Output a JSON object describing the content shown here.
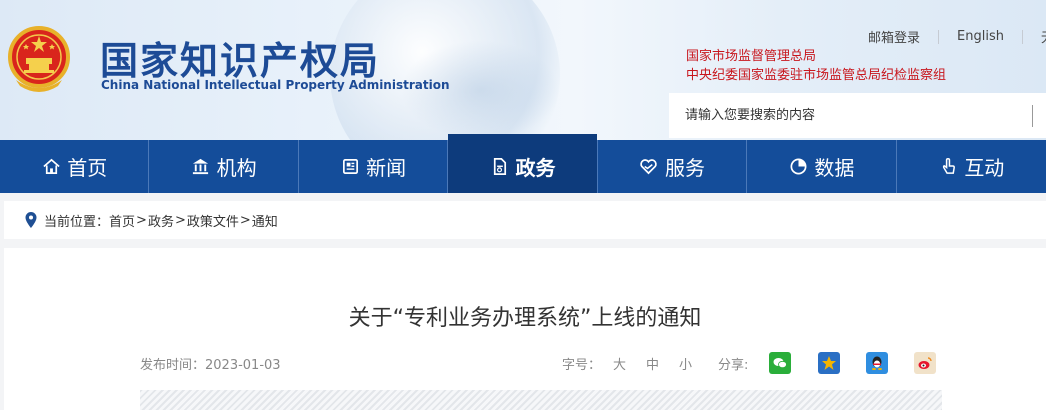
{
  "header": {
    "logo_cn": "国家知识产权局",
    "logo_en": "China National Intellectual Property Administration",
    "top_links": {
      "mail_login": "邮箱登录",
      "english": "English",
      "more": "无"
    },
    "orgs": [
      "国家市场监督管理总局",
      "中央纪委国家监委驻市场监管总局纪检监察组"
    ],
    "search": {
      "placeholder": "请输入您要搜索的内容"
    }
  },
  "nav": {
    "items": [
      {
        "label": "首页",
        "icon": "home-icon"
      },
      {
        "label": "机构",
        "icon": "institution-icon"
      },
      {
        "label": "新闻",
        "icon": "news-icon"
      },
      {
        "label": "政务",
        "icon": "document-icon",
        "active": true
      },
      {
        "label": "服务",
        "icon": "service-heart-icon"
      },
      {
        "label": "数据",
        "icon": "pie-chart-icon"
      },
      {
        "label": "互动",
        "icon": "hand-pointer-icon"
      }
    ]
  },
  "breadcrumb": {
    "prefix": "当前位置：",
    "items": [
      "首页",
      "政务",
      "政策文件",
      "通知"
    ],
    "separator": ">"
  },
  "article": {
    "title": "关于“专利业务办理系统”上线的通知",
    "date_label": "发布时间：2023-01-03",
    "font_label": "字号：",
    "font_sizes": [
      "大",
      "中",
      "小"
    ],
    "share_label": "分享:",
    "share_targets": [
      "wechat-icon",
      "qzone-icon",
      "qq-icon",
      "weibo-icon"
    ]
  },
  "colors": {
    "nav_bg": "#144d9a",
    "nav_active": "#0d3b7c",
    "logo_blue": "#1d4b96",
    "org_red": "#c8161d",
    "wechat": "#2aae3a",
    "qzone": "#f4b400",
    "qq": "#2f8ee0",
    "weibo": "#e6162d"
  }
}
